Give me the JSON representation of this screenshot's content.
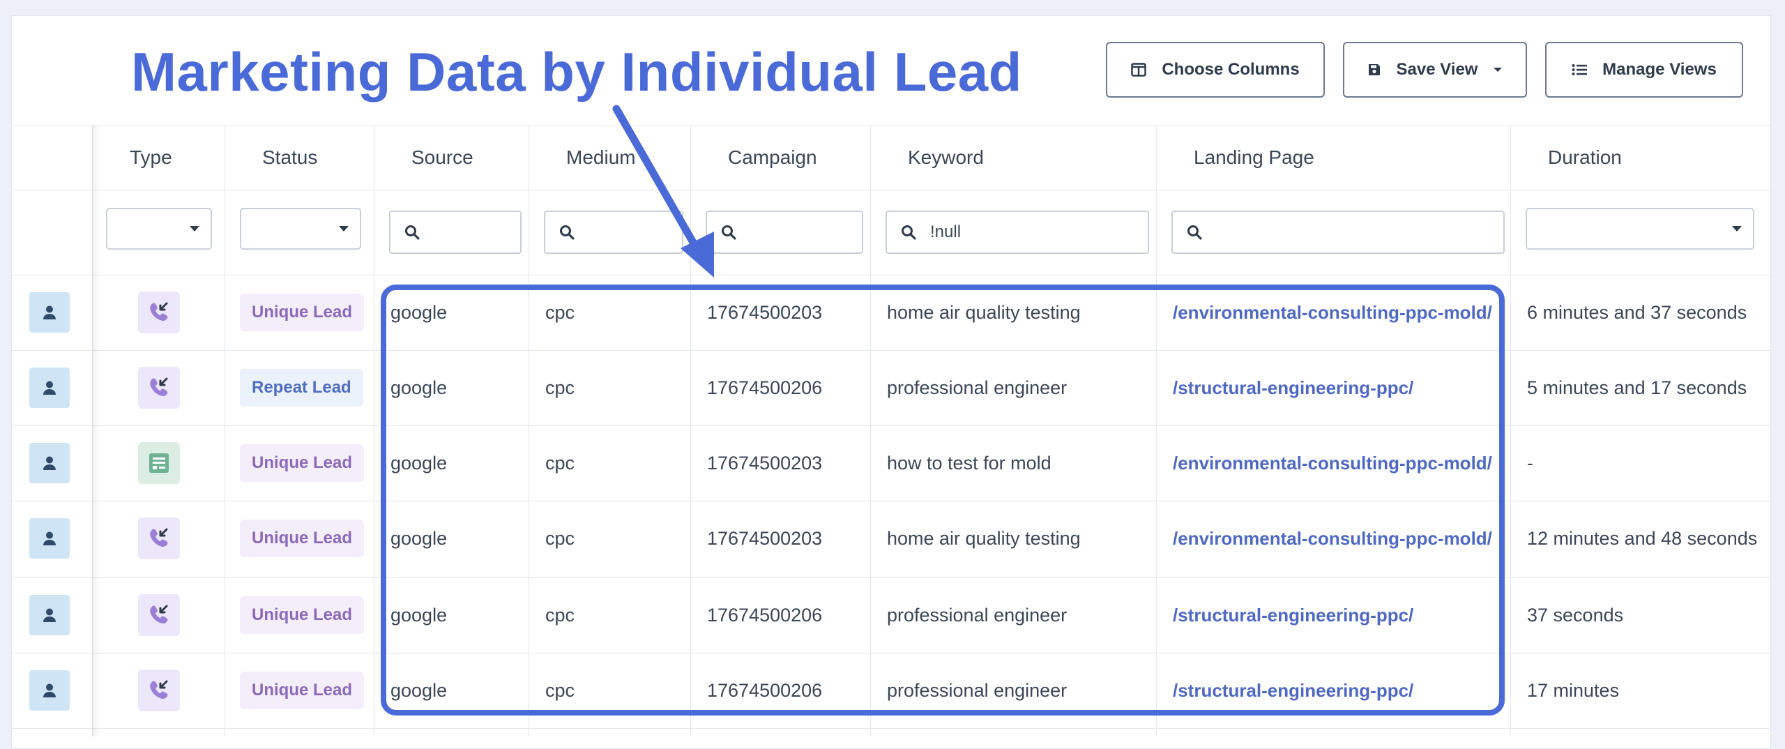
{
  "annotation": {
    "headline": "Marketing Data by Individual Lead",
    "accent_color": "#4a6ad8"
  },
  "toolbar": {
    "choose_columns": "Choose Columns",
    "save_view": "Save View",
    "manage_views": "Manage Views"
  },
  "columns": {
    "type": "Type",
    "status": "Status",
    "source": "Source",
    "medium": "Medium",
    "campaign": "Campaign",
    "keyword": "Keyword",
    "landing_page": "Landing Page",
    "duration": "Duration"
  },
  "filters": {
    "keyword_value": "!null"
  },
  "rows": [
    {
      "type_icon": "incoming-call-icon",
      "status": "Unique Lead",
      "source": "google",
      "medium": "cpc",
      "campaign": "17674500203",
      "keyword": "home air quality testing",
      "landing_page": "/environmental-consulting-ppc-mold/",
      "duration": "6 minutes and 37 seconds"
    },
    {
      "type_icon": "incoming-call-icon",
      "status": "Repeat Lead",
      "source": "google",
      "medium": "cpc",
      "campaign": "17674500206",
      "keyword": "professional engineer",
      "landing_page": "/structural-engineering-ppc/",
      "duration": "5 minutes and 17 seconds"
    },
    {
      "type_icon": "form-icon",
      "status": "Unique Lead",
      "source": "google",
      "medium": "cpc",
      "campaign": "17674500203",
      "keyword": "how to test for mold",
      "landing_page": "/environmental-consulting-ppc-mold/",
      "duration": "-"
    },
    {
      "type_icon": "incoming-call-icon",
      "status": "Unique Lead",
      "source": "google",
      "medium": "cpc",
      "campaign": "17674500203",
      "keyword": "home air quality testing",
      "landing_page": "/environmental-consulting-ppc-mold/",
      "duration": "12 minutes and 48 seconds"
    },
    {
      "type_icon": "incoming-call-icon",
      "status": "Unique Lead",
      "source": "google",
      "medium": "cpc",
      "campaign": "17674500206",
      "keyword": "professional engineer",
      "landing_page": "/structural-engineering-ppc/",
      "duration": "37 seconds"
    },
    {
      "type_icon": "incoming-call-icon",
      "status": "Unique Lead",
      "source": "google",
      "medium": "cpc",
      "campaign": "17674500206",
      "keyword": "professional engineer",
      "landing_page": "/structural-engineering-ppc/",
      "duration": "17 minutes"
    }
  ]
}
